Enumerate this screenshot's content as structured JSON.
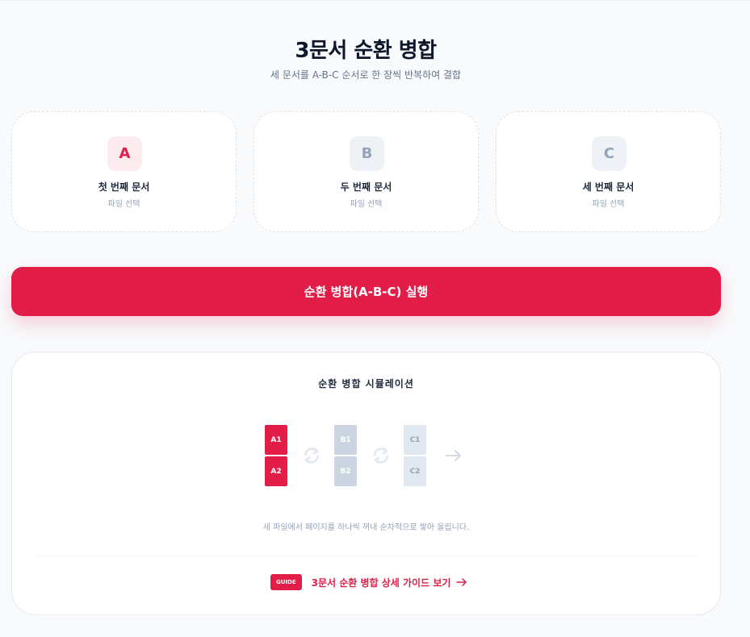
{
  "header": {
    "title": "3문서 순환 병합",
    "subtitle": "세 문서를 A-B-C 순서로 한 장씩 반복하여 결합"
  },
  "documents": [
    {
      "letter": "A",
      "label": "첫 번째 문서",
      "hint": "파일 선택"
    },
    {
      "letter": "B",
      "label": "두 번째 문서",
      "hint": "파일 선택"
    },
    {
      "letter": "C",
      "label": "세 번째 문서",
      "hint": "파일 선택"
    }
  ],
  "run_button": {
    "label": "순환 병합(A-B-C) 실행"
  },
  "simulation": {
    "title": "순환 병합 시뮬레이션",
    "pages": {
      "a": [
        "A1",
        "A2"
      ],
      "b": [
        "B1",
        "B2"
      ],
      "c": [
        "C1",
        "C2"
      ]
    },
    "description": "세 파일에서 페이지를 하나씩 꺼내 순차적으로 쌓아 올립니다.",
    "guide": {
      "tag": "GUIDE",
      "text": "3문서 순환 병합 상세 가이드 보기"
    }
  },
  "colors": {
    "accent": "#e11d48",
    "background": "#f8fafc",
    "muted": "#94a3b8"
  },
  "icons": {
    "cycle": "refresh-cycle-icon",
    "output": "arrow-right-icon"
  }
}
